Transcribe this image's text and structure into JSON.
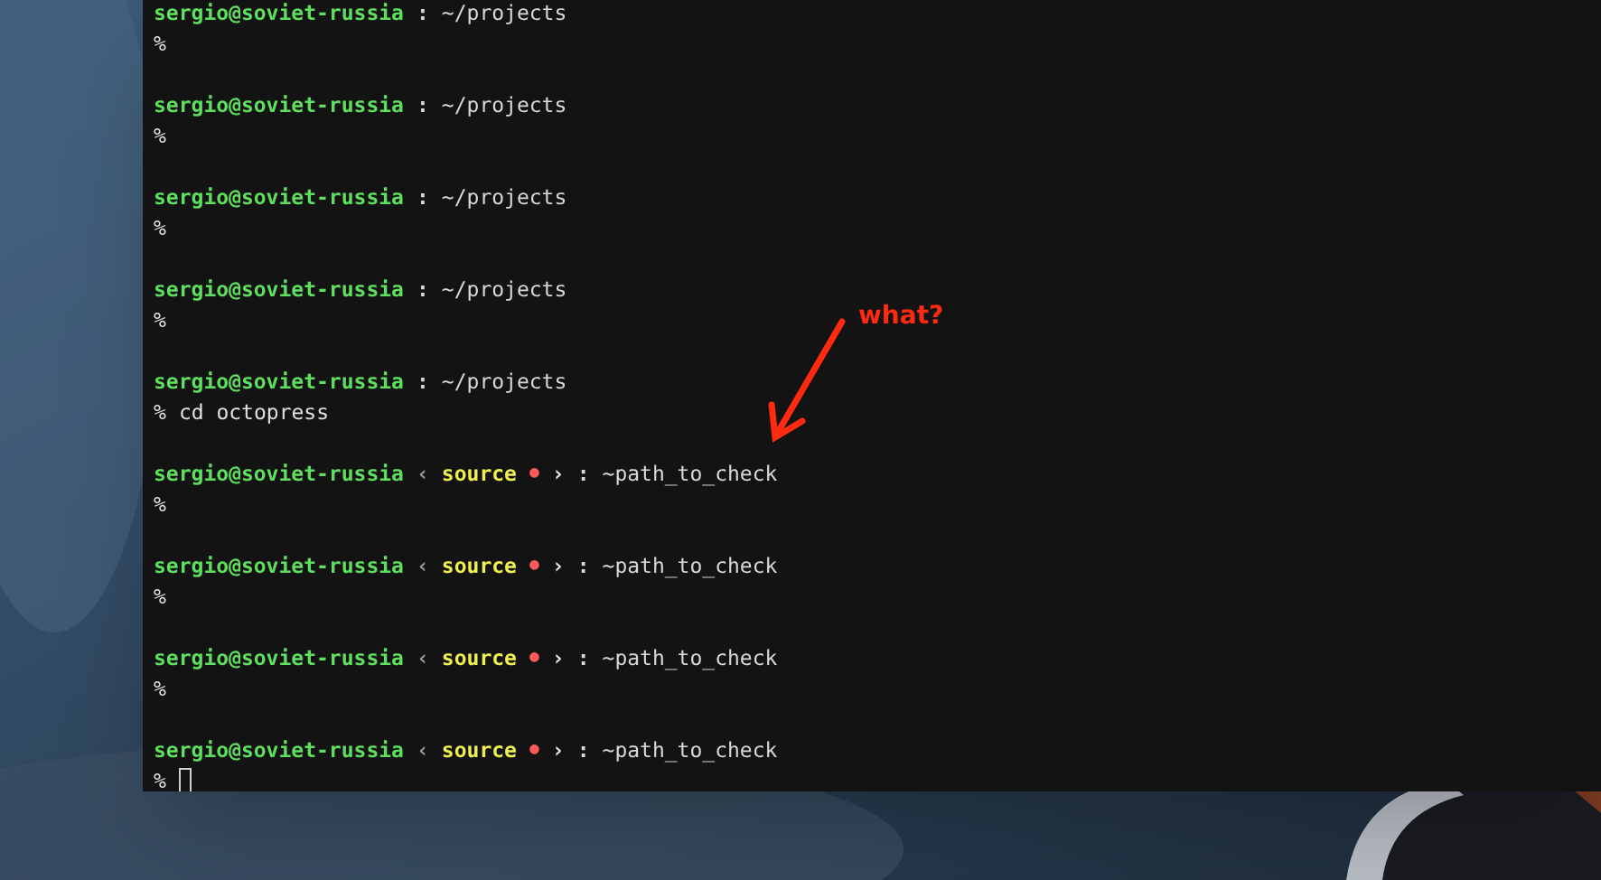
{
  "terminal": {
    "lines": [
      {
        "kind": "prompt",
        "user_host": "sergio@soviet-russia",
        "separator": ":",
        "path": "~/projects"
      },
      {
        "kind": "command",
        "symbol": "%"
      },
      {
        "kind": "blank"
      },
      {
        "kind": "prompt",
        "user_host": "sergio@soviet-russia",
        "separator": ":",
        "path": "~/projects"
      },
      {
        "kind": "command",
        "symbol": "%"
      },
      {
        "kind": "blank"
      },
      {
        "kind": "prompt",
        "user_host": "sergio@soviet-russia",
        "separator": ":",
        "path": "~/projects"
      },
      {
        "kind": "command",
        "symbol": "%"
      },
      {
        "kind": "blank"
      },
      {
        "kind": "prompt",
        "user_host": "sergio@soviet-russia",
        "separator": ":",
        "path": "~/projects"
      },
      {
        "kind": "command",
        "symbol": "%"
      },
      {
        "kind": "blank"
      },
      {
        "kind": "prompt",
        "user_host": "sergio@soviet-russia",
        "separator": ":",
        "path": "~/projects"
      },
      {
        "kind": "command",
        "symbol": "%",
        "command": "cd octopress"
      },
      {
        "kind": "blank"
      },
      {
        "kind": "prompt",
        "user_host": "sergio@soviet-russia",
        "branch": {
          "open": "‹",
          "name": "source",
          "dirty_mark": "●",
          "close": "›"
        },
        "separator": ":",
        "path": "~path_to_check"
      },
      {
        "kind": "command",
        "symbol": "%"
      },
      {
        "kind": "blank"
      },
      {
        "kind": "prompt",
        "user_host": "sergio@soviet-russia",
        "branch": {
          "open": "‹",
          "name": "source",
          "dirty_mark": "●",
          "close": "›"
        },
        "separator": ":",
        "path": "~path_to_check"
      },
      {
        "kind": "command",
        "symbol": "%"
      },
      {
        "kind": "blank"
      },
      {
        "kind": "prompt",
        "user_host": "sergio@soviet-russia",
        "branch": {
          "open": "‹",
          "name": "source",
          "dirty_mark": "●",
          "close": "›"
        },
        "separator": ":",
        "path": "~path_to_check"
      },
      {
        "kind": "command",
        "symbol": "%"
      },
      {
        "kind": "blank"
      },
      {
        "kind": "prompt",
        "user_host": "sergio@soviet-russia",
        "branch": {
          "open": "‹",
          "name": "source",
          "dirty_mark": "●",
          "close": "›"
        },
        "separator": ":",
        "path": "~path_to_check"
      },
      {
        "kind": "command",
        "symbol": "%",
        "cursor": true
      }
    ]
  },
  "annotation": {
    "text": "what?"
  }
}
